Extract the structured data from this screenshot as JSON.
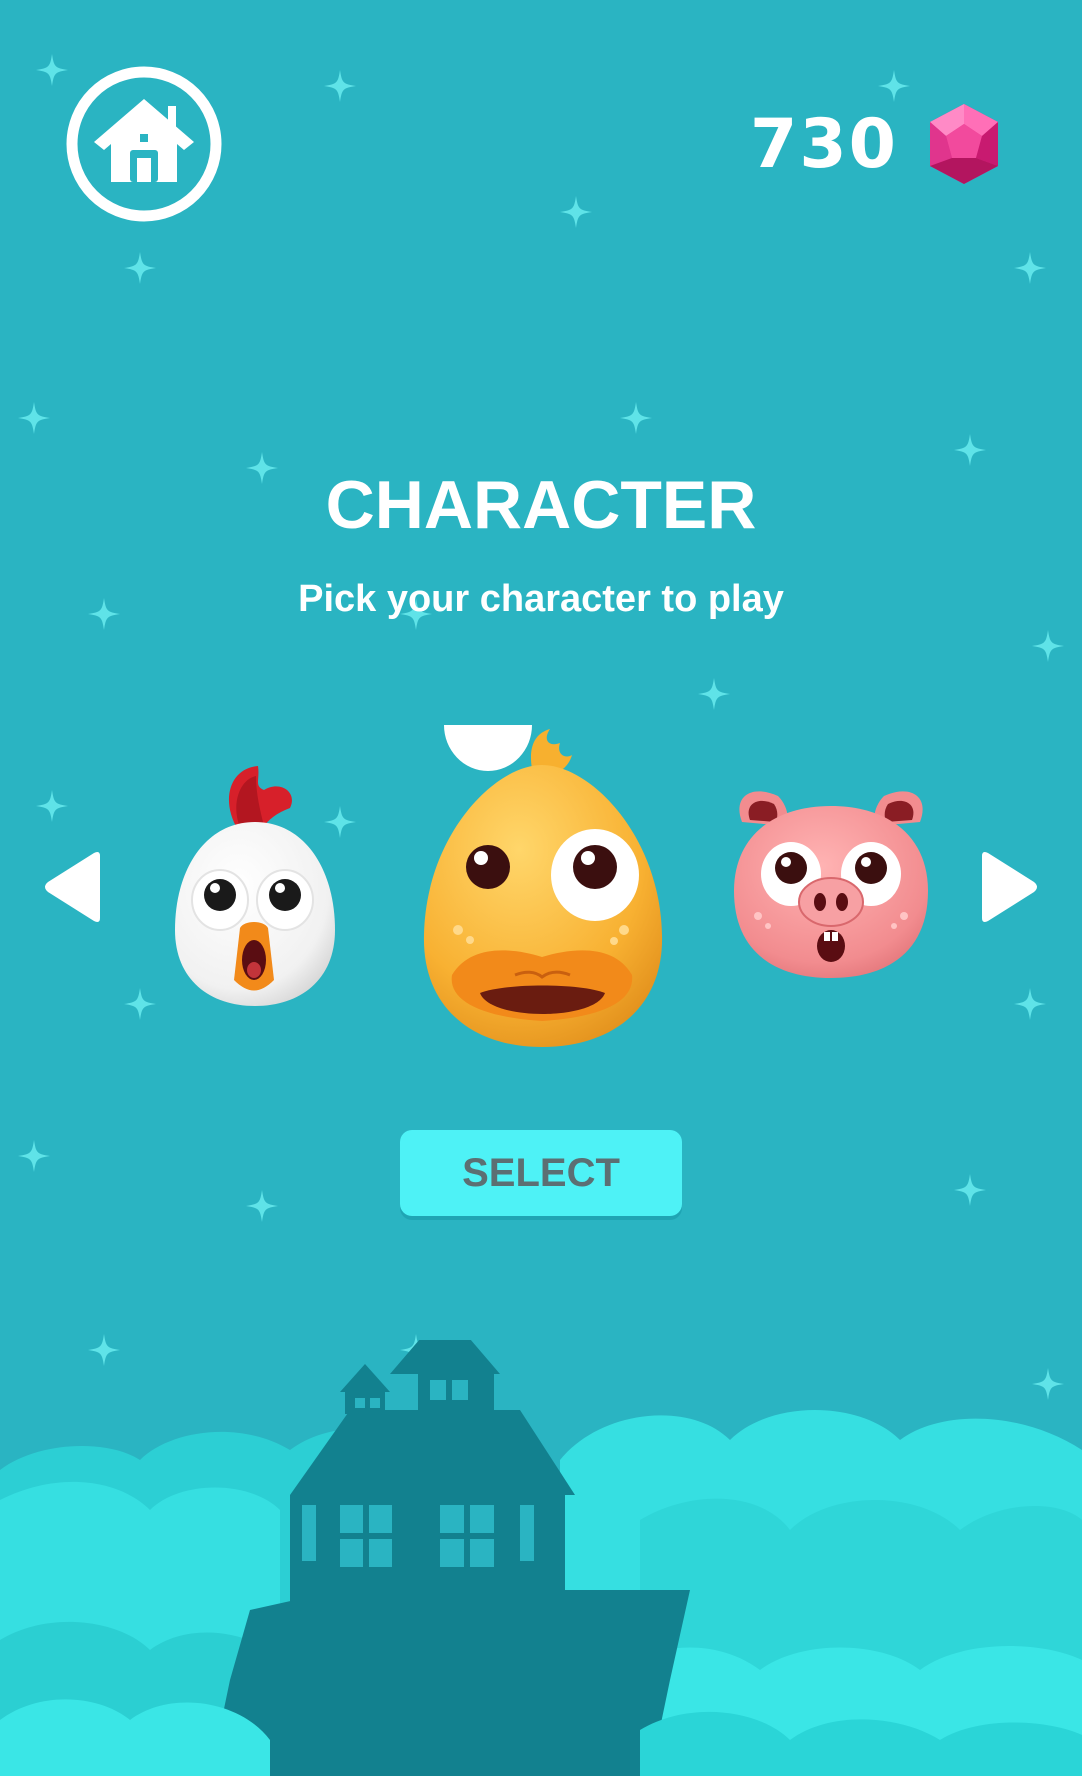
{
  "screen": {
    "background_color": "#2ab4c2"
  },
  "header": {
    "home_icon": "home-icon",
    "gem_count": "730",
    "gem_icon": "gem-icon",
    "gem_color": "#ec2b8c"
  },
  "main": {
    "title": "CHARACTER",
    "subtitle": "Pick your character to play",
    "characters": [
      {
        "id": "chicken",
        "selected": false
      },
      {
        "id": "duck",
        "selected": true
      },
      {
        "id": "pig",
        "selected": false
      }
    ],
    "prev_icon": "arrow-left-icon",
    "next_icon": "arrow-right-icon",
    "select_label": "SELECT",
    "select_color": "#4ef2f6"
  },
  "scenery": {
    "cloud_color": "#36dfe1",
    "house_color": "#12818f"
  }
}
